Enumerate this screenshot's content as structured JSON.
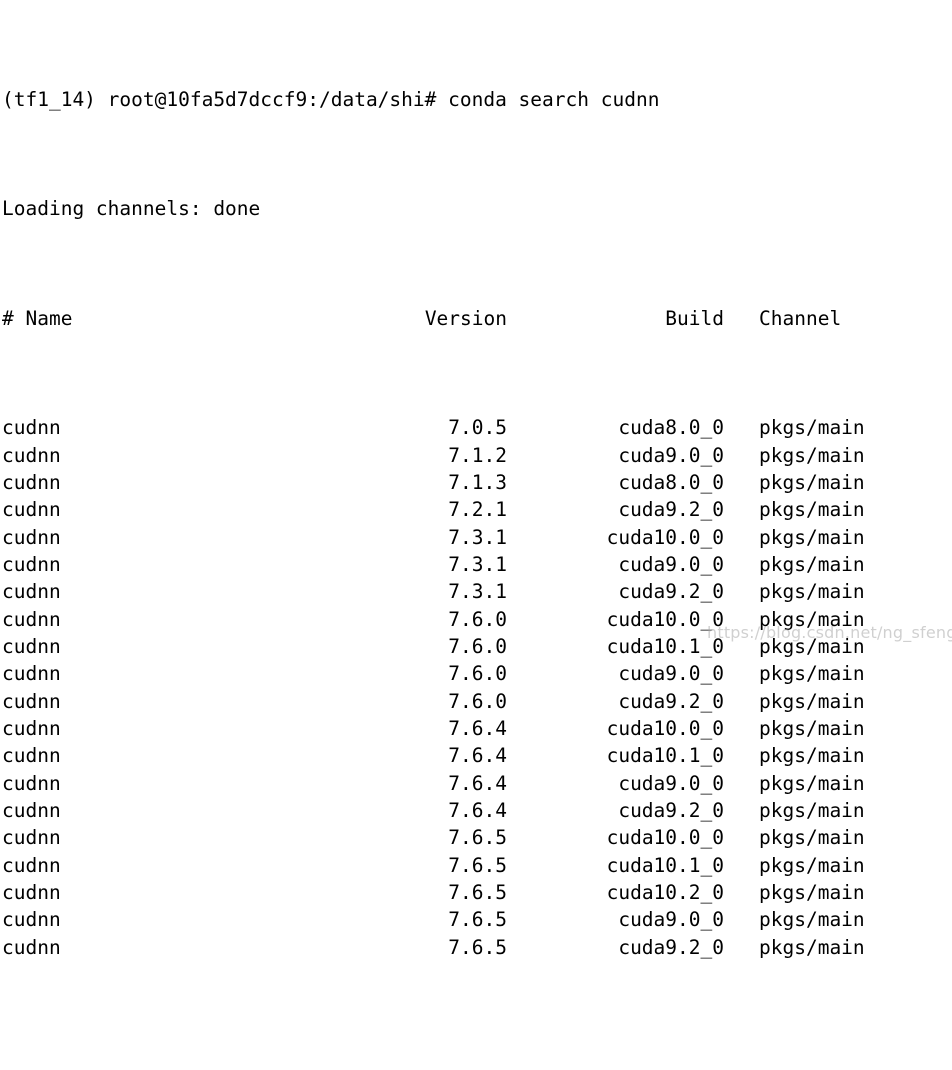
{
  "terminal": {
    "background_color": "#ffffff",
    "text_color": "#000000",
    "prompt_line": "(tf1_14) root@10fa5d7dccf9:/data/shi# conda search cudnn",
    "status_line": "Loading channels: done",
    "env_name": "tf1_14",
    "user": "root",
    "host": "10fa5d7dccf9",
    "cwd": "/data/shi",
    "command": "conda search cudnn"
  },
  "table": {
    "headers": {
      "name": "# Name",
      "version": "Version",
      "build": "Build",
      "channel": "Channel"
    },
    "rows": [
      {
        "name": "cudnn",
        "version": "7.0.5",
        "build": "cuda8.0_0",
        "channel": "pkgs/main"
      },
      {
        "name": "cudnn",
        "version": "7.1.2",
        "build": "cuda9.0_0",
        "channel": "pkgs/main"
      },
      {
        "name": "cudnn",
        "version": "7.1.3",
        "build": "cuda8.0_0",
        "channel": "pkgs/main"
      },
      {
        "name": "cudnn",
        "version": "7.2.1",
        "build": "cuda9.2_0",
        "channel": "pkgs/main"
      },
      {
        "name": "cudnn",
        "version": "7.3.1",
        "build": "cuda10.0_0",
        "channel": "pkgs/main"
      },
      {
        "name": "cudnn",
        "version": "7.3.1",
        "build": "cuda9.0_0",
        "channel": "pkgs/main"
      },
      {
        "name": "cudnn",
        "version": "7.3.1",
        "build": "cuda9.2_0",
        "channel": "pkgs/main"
      },
      {
        "name": "cudnn",
        "version": "7.6.0",
        "build": "cuda10.0_0",
        "channel": "pkgs/main"
      },
      {
        "name": "cudnn",
        "version": "7.6.0",
        "build": "cuda10.1_0",
        "channel": "pkgs/main"
      },
      {
        "name": "cudnn",
        "version": "7.6.0",
        "build": "cuda9.0_0",
        "channel": "pkgs/main"
      },
      {
        "name": "cudnn",
        "version": "7.6.0",
        "build": "cuda9.2_0",
        "channel": "pkgs/main"
      },
      {
        "name": "cudnn",
        "version": "7.6.4",
        "build": "cuda10.0_0",
        "channel": "pkgs/main"
      },
      {
        "name": "cudnn",
        "version": "7.6.4",
        "build": "cuda10.1_0",
        "channel": "pkgs/main"
      },
      {
        "name": "cudnn",
        "version": "7.6.4",
        "build": "cuda9.0_0",
        "channel": "pkgs/main"
      },
      {
        "name": "cudnn",
        "version": "7.6.4",
        "build": "cuda9.2_0",
        "channel": "pkgs/main"
      },
      {
        "name": "cudnn",
        "version": "7.6.5",
        "build": "cuda10.0_0",
        "channel": "pkgs/main"
      },
      {
        "name": "cudnn",
        "version": "7.6.5",
        "build": "cuda10.1_0",
        "channel": "pkgs/main"
      },
      {
        "name": "cudnn",
        "version": "7.6.5",
        "build": "cuda10.2_0",
        "channel": "pkgs/main"
      },
      {
        "name": "cudnn",
        "version": "7.6.5",
        "build": "cuda9.0_0",
        "channel": "pkgs/main"
      },
      {
        "name": "cudnn",
        "version": "7.6.5",
        "build": "cuda9.2_0",
        "channel": "pkgs/main"
      }
    ]
  },
  "watermark": {
    "text": "https://blog.csdn.net/ng_sfeng",
    "color": "#aaaaaa"
  }
}
